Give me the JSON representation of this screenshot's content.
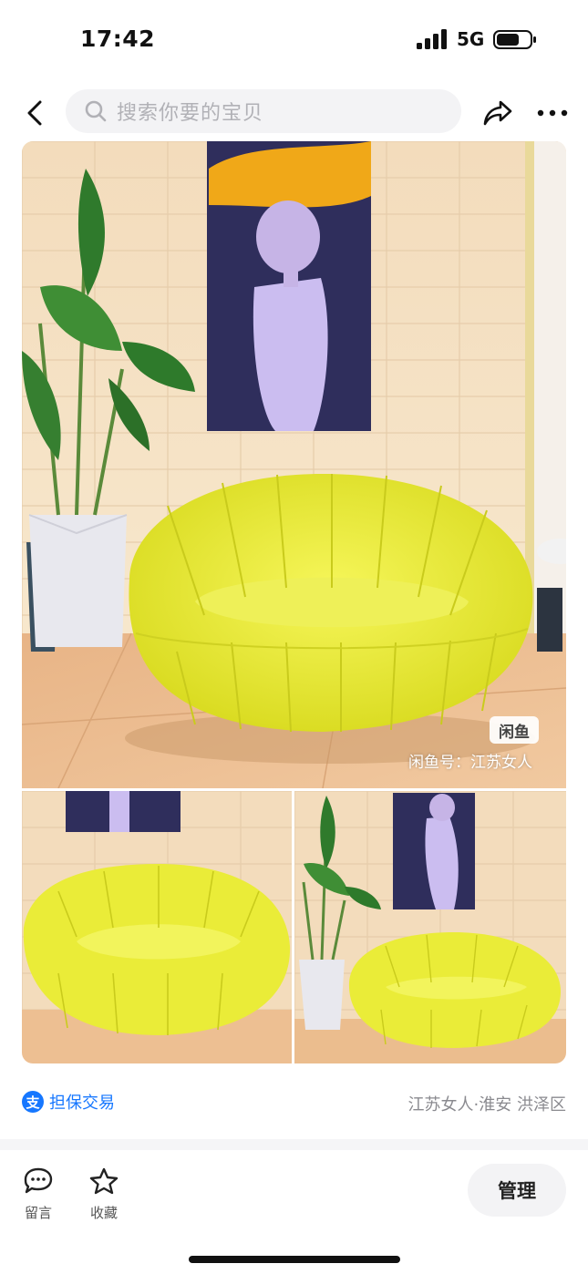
{
  "status_bar": {
    "time": "17:42",
    "network": "5G"
  },
  "nav": {
    "search_placeholder": "搜索你要的宝贝",
    "back_icon": "chevron-left-icon",
    "share_icon": "share-icon",
    "more_icon": "more-dots-icon"
  },
  "gallery": {
    "watermark_logo": "闲鱼",
    "watermark_text": "闲鱼号：江苏女人",
    "photo_count": 3,
    "subject": "yellow pumpkin sofa"
  },
  "info": {
    "guarantee_label": "担保交易",
    "guarantee_icon_char": "支",
    "location": "江苏女人·淮安 洪泽区"
  },
  "bottom_bar": {
    "comment_label": "留言",
    "favorite_label": "收藏",
    "manage_label": "管理"
  },
  "colors": {
    "accent_blue": "#1677ff",
    "sofa_yellow": "#eef03a"
  }
}
